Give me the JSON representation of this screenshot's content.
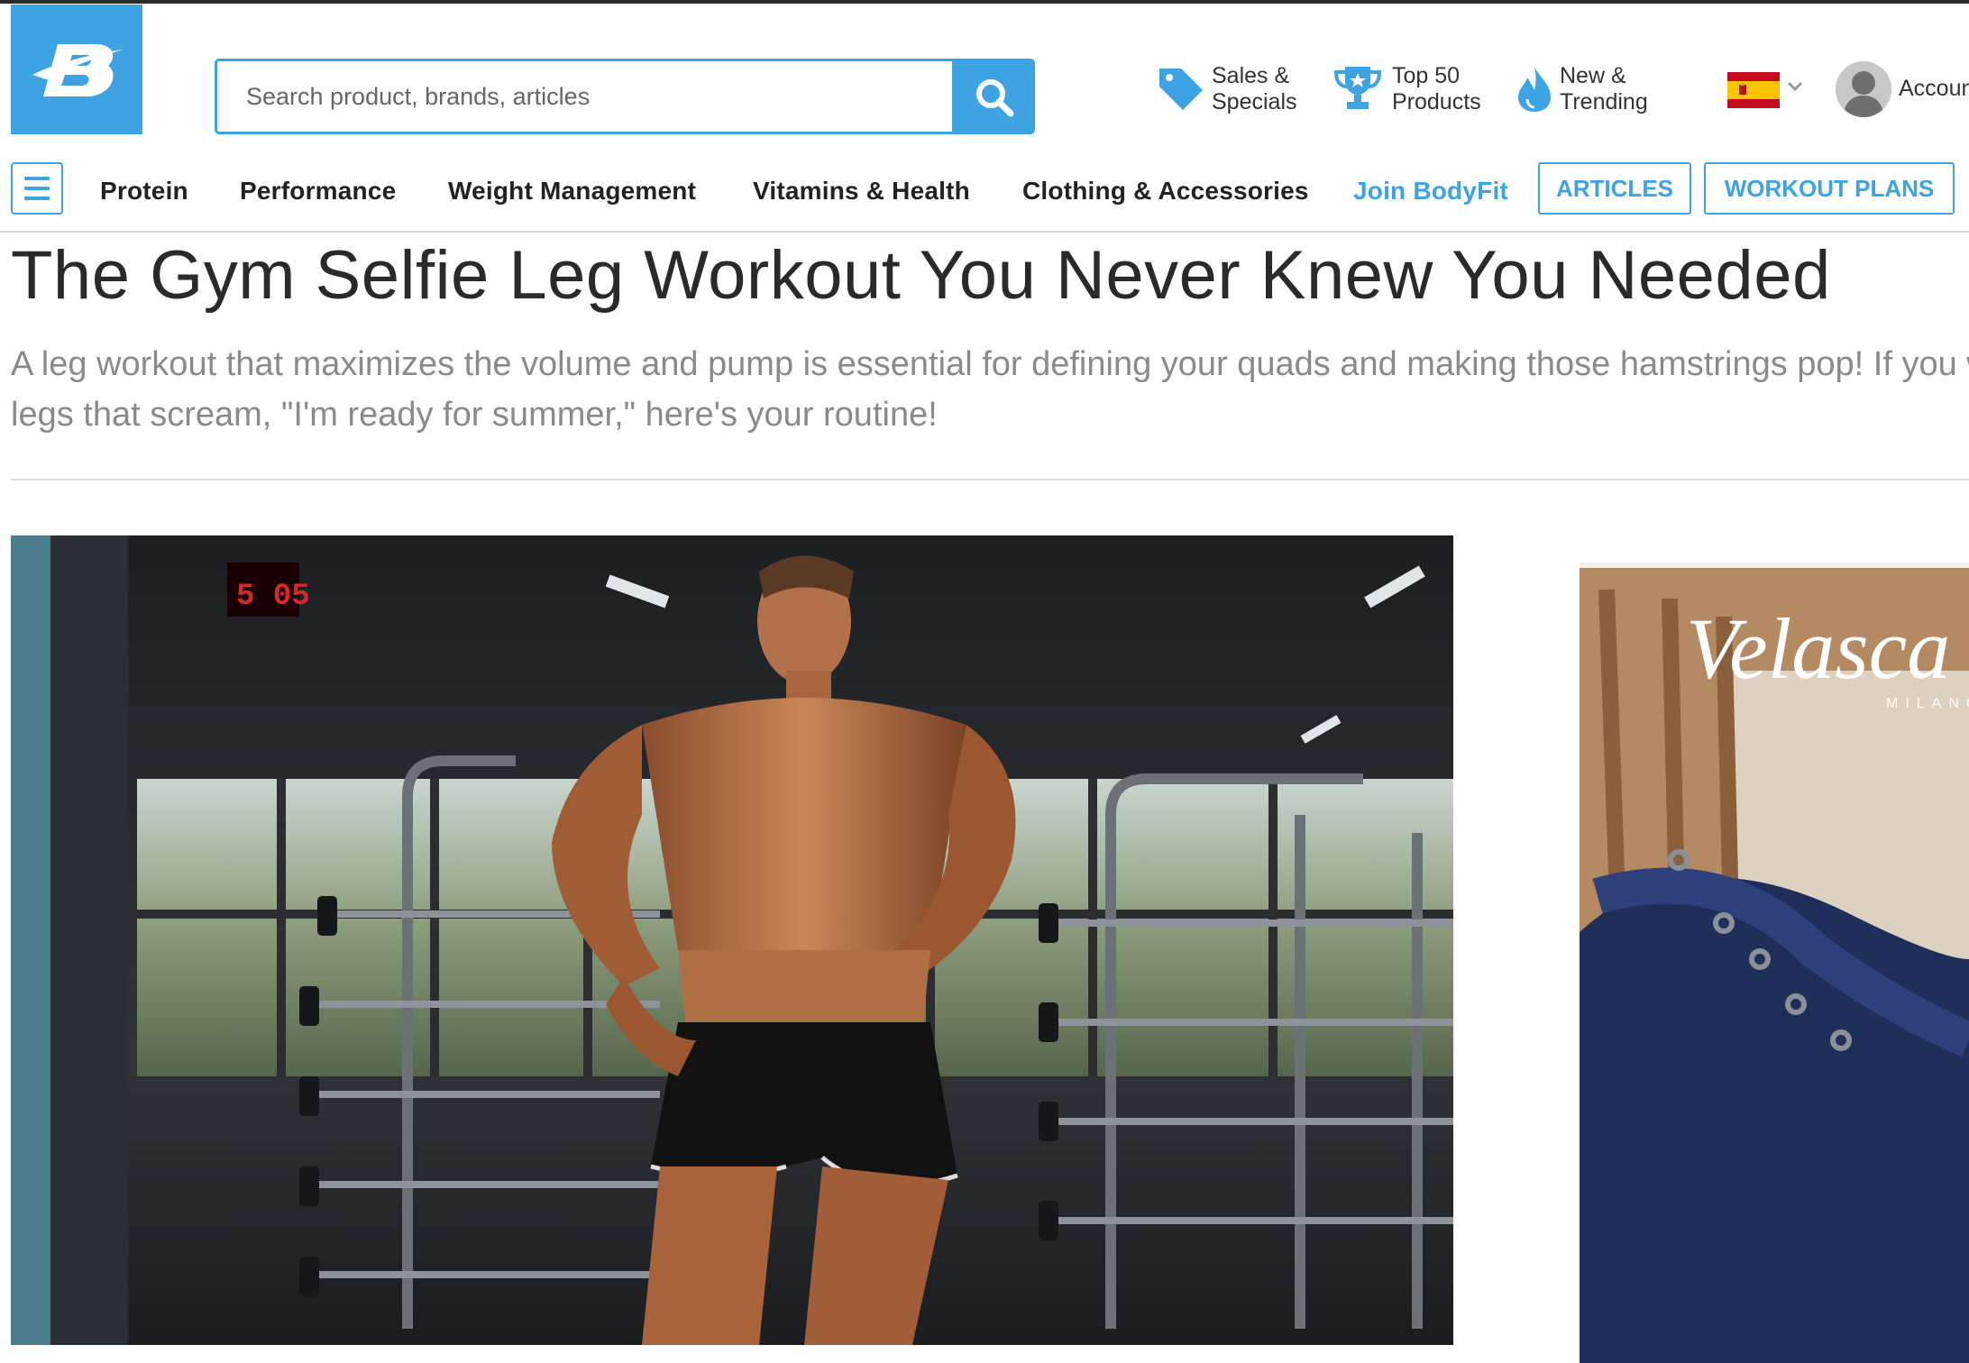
{
  "header": {
    "logo_icon": "bodybuilding-b-logo",
    "search": {
      "placeholder": "Search product, brands, articles",
      "button_icon": "search-icon"
    },
    "links": [
      {
        "line1": "Sales &",
        "line2": "Specials",
        "icon": "tag-icon"
      },
      {
        "line1": "Top 50",
        "line2": "Products",
        "icon": "trophy-icon"
      },
      {
        "line1": "New &",
        "line2": "Trending",
        "icon": "flame-icon"
      }
    ],
    "country_flag": "spain-flag",
    "account_label": "Account"
  },
  "nav": {
    "items": [
      "Protein",
      "Performance",
      "Weight Management",
      "Vitamins & Health",
      "Clothing & Accessories",
      "Join BodyFit"
    ],
    "buttons": [
      "ARTICLES",
      "WORKOUT PLANS"
    ]
  },
  "article": {
    "title": "The Gym Selfie Leg Workout You Never Knew You Needed",
    "description_line1": "A leg workout that maximizes the volume and pump is essential for defining your quads and making those hamstrings pop! If you want",
    "description_line2": "legs that scream, \"I'm ready for summer,\" here's your routine!"
  },
  "ad": {
    "brand": "Velasca",
    "sub": "MILANO"
  },
  "colors": {
    "accent": "#3da3e3",
    "title": "#2a2a2a",
    "subtitle": "#8a8a8a"
  }
}
